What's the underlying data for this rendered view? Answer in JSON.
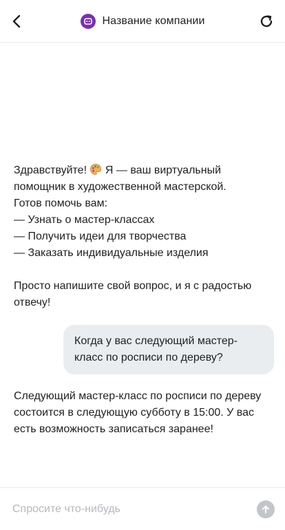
{
  "header": {
    "title": "Название компании",
    "back_icon": "chevron-left-icon",
    "refresh_icon": "refresh-icon",
    "logo_icon": "chat-bot-logo-icon"
  },
  "colors": {
    "accent": "#7a2fb3",
    "user_bubble": "#eaedf0",
    "send_button": "#c2c5ca",
    "placeholder": "#b5b8be"
  },
  "messages": [
    {
      "role": "bot",
      "text_before_emoji": "Здравствуйте! ",
      "emoji": "palette-emoji",
      "text_after_emoji": " Я — ваш виртуальный помощник в художественной мастерской.\nГотов помочь вам:\n— Узнать о мастер-классах\n— Получить идеи для творчества\n— Заказать индивидуальные изделия\n\nПросто напишите свой вопрос, и я с радостью отвечу!"
    },
    {
      "role": "user",
      "text": "Когда у вас следующий мастер-класс по росписи по дереву?"
    },
    {
      "role": "bot",
      "text": "Следующий мастер-класс по росписи по дереву состоится в следующую субботу в 15:00. У вас есть возможность записаться заранее!"
    }
  ],
  "input": {
    "placeholder": "Спросите что-нибудь",
    "value": "",
    "send_icon": "arrow-up-icon"
  }
}
